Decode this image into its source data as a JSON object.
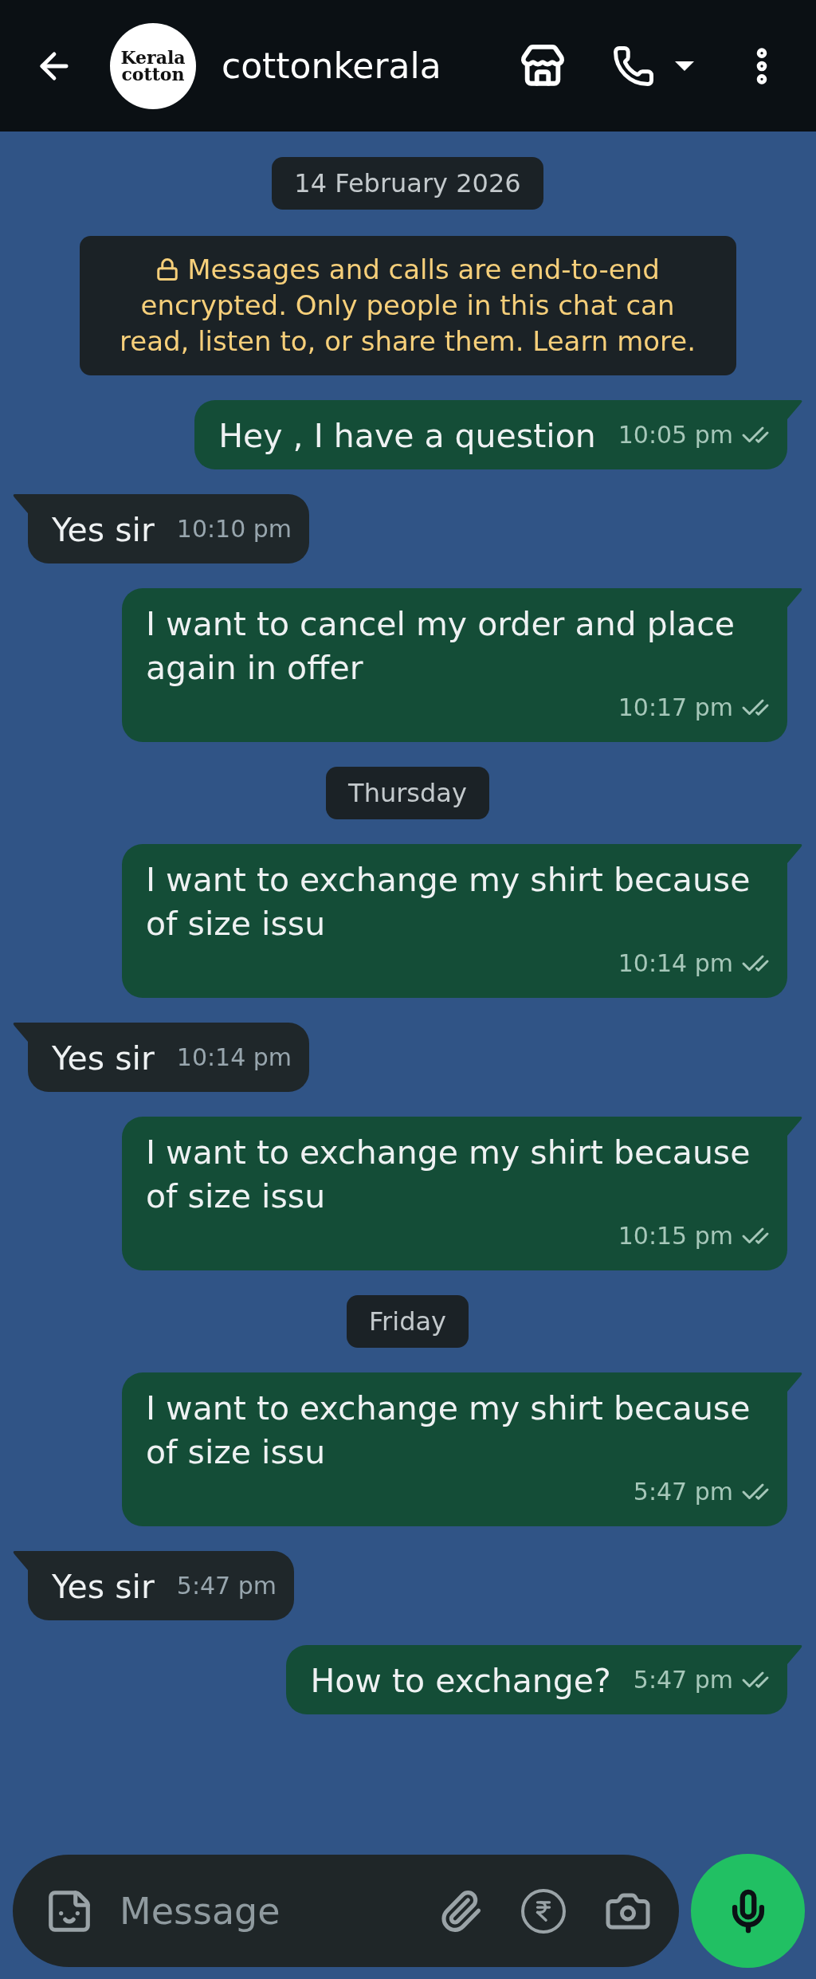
{
  "header": {
    "avatar": {
      "line1": "Kerala",
      "line2": "cotton"
    },
    "title": "cottonkerala"
  },
  "messages": [
    {
      "kind": "date",
      "text": "14 February 2026"
    },
    {
      "kind": "notice",
      "text": "Messages and calls are end-to-end encrypted. Only people in this chat can read, listen to, or share them. Learn more."
    },
    {
      "kind": "out",
      "text": "Hey , I have a question",
      "time": "10:05 pm",
      "read": false
    },
    {
      "kind": "in",
      "text": "Yes sir",
      "time": "10:10 pm"
    },
    {
      "kind": "out",
      "text": "I want to cancel my order and place again in offer",
      "time": "10:17 pm",
      "read": false
    },
    {
      "kind": "date",
      "text": "Thursday"
    },
    {
      "kind": "out",
      "text": "I want to exchange my shirt because of size issu",
      "time": "10:14 pm",
      "read": false
    },
    {
      "kind": "in",
      "text": "Yes sir",
      "time": "10:14 pm"
    },
    {
      "kind": "out",
      "text": "I want to exchange my shirt because of size issu",
      "time": "10:15 pm",
      "read": false
    },
    {
      "kind": "date",
      "text": "Friday"
    },
    {
      "kind": "out",
      "text": "I want to exchange my shirt because of size issu",
      "time": "5:47 pm",
      "read": false
    },
    {
      "kind": "in",
      "text": "Yes sir",
      "time": "5:47 pm"
    },
    {
      "kind": "out",
      "text": "How to exchange?",
      "time": "5:47 pm",
      "read": false
    }
  ],
  "composer": {
    "placeholder": "Message"
  }
}
